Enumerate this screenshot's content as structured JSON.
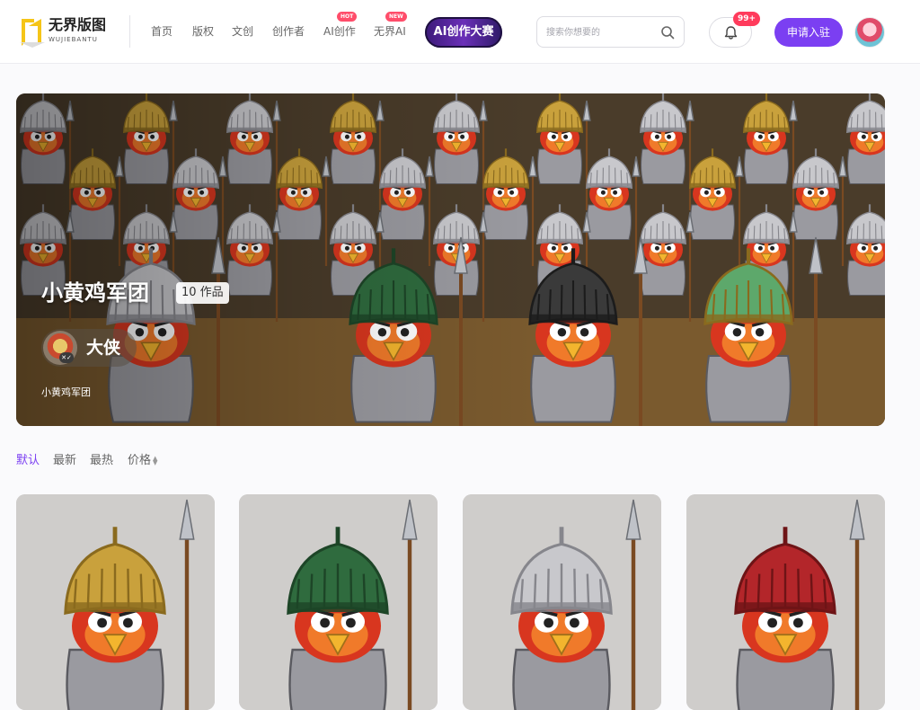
{
  "header": {
    "logo": {
      "name": "无界版图",
      "subtitle": "WUJIEBANTU"
    },
    "nav": [
      {
        "label": "首页",
        "badge": ""
      },
      {
        "label": "版权",
        "badge": ""
      },
      {
        "label": "文创",
        "badge": ""
      },
      {
        "label": "创作者",
        "badge": ""
      },
      {
        "label": "AI创作",
        "badge": "HOT"
      },
      {
        "label": "无界AI",
        "badge": "NEW"
      }
    ],
    "contest_button": "AI创作大赛",
    "search": {
      "placeholder": "搜索你想要的",
      "icon": "search-icon"
    },
    "notifications": {
      "count": "99+",
      "icon": "bell-icon"
    },
    "apply_button": "申请入驻"
  },
  "banner": {
    "title": "小黄鸡军团",
    "works_count": "10 作品",
    "author_name": "大侠",
    "caption": "小黄鸡军团"
  },
  "sort_options": [
    {
      "label": "默认",
      "active": true
    },
    {
      "label": "最新",
      "active": false
    },
    {
      "label": "最热",
      "active": false
    },
    {
      "label": "价格",
      "active": false
    }
  ],
  "cards": [
    {
      "helmet": "gold",
      "weapon": "spear"
    },
    {
      "helmet": "green",
      "weapon": "glaive"
    },
    {
      "helmet": "silver",
      "weapon": "spear"
    },
    {
      "helmet": "red",
      "weapon": "spear"
    }
  ],
  "colors": {
    "accent": "#7b3ff2",
    "badge_red": "#ff3b5c",
    "text_muted": "#666666"
  }
}
